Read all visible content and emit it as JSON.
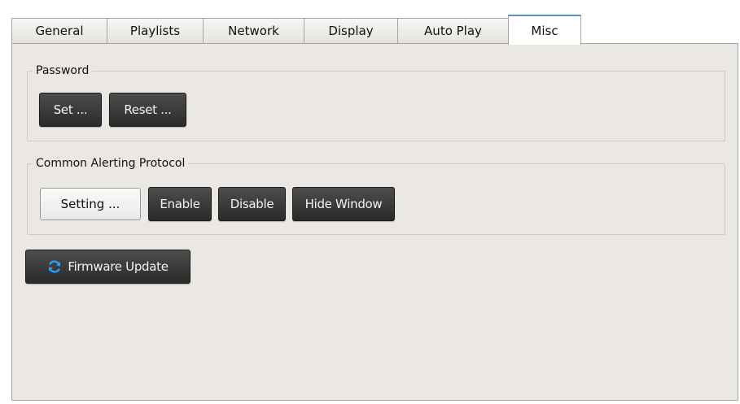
{
  "tabs": [
    {
      "label": "General"
    },
    {
      "label": "Playlists"
    },
    {
      "label": "Network"
    },
    {
      "label": "Display"
    },
    {
      "label": "Auto Play"
    },
    {
      "label": "Misc"
    }
  ],
  "active_tab": "Misc",
  "password_group": {
    "title": "Password",
    "set_label": "Set ...",
    "reset_label": "Reset ..."
  },
  "cap_group": {
    "title": "Common Alerting Protocol",
    "setting_label": "Setting ...",
    "enable_label": "Enable",
    "disable_label": "Disable",
    "hide_window_label": "Hide Window"
  },
  "firmware": {
    "label": "Firmware Update",
    "icon": "refresh-icon",
    "icon_color": "#1e88e5"
  },
  "colors": {
    "panel_bg": "#ebe8e3",
    "active_tab_accent": "#5a8fd0",
    "dark_button": "#333333"
  }
}
